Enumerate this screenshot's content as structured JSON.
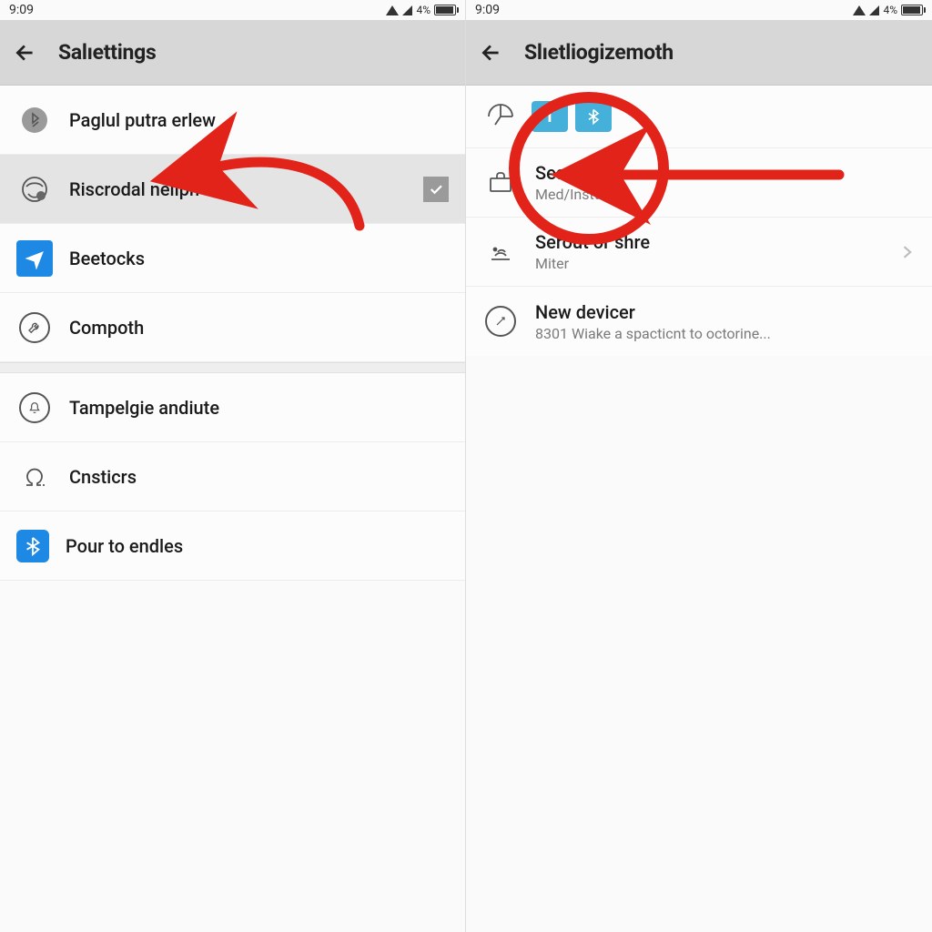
{
  "left": {
    "status": {
      "time": "9:09",
      "battery_pct": "4%"
    },
    "header": {
      "title": "Salıettings"
    },
    "rows": [
      {
        "id": "paglul",
        "label": "Paglul putra erlew",
        "icon": "bluetooth-dot"
      },
      {
        "id": "riscrodal",
        "label": "Riscrodal neliph",
        "icon": "globe-cog",
        "selected": true,
        "checked": true
      },
      {
        "id": "beetocks",
        "label": "Beetocks",
        "icon": "plane-blue"
      },
      {
        "id": "compoth",
        "label": "Compoth",
        "icon": "wrench-ring"
      },
      {
        "gap": true
      },
      {
        "id": "tampelgie",
        "label": "Tampelgie andiute",
        "icon": "bell-ring"
      },
      {
        "id": "cnsticrs",
        "label": "Cnsticrs",
        "icon": "omega"
      },
      {
        "id": "pour",
        "label": "Pour to endles",
        "icon": "bt-blue"
      }
    ]
  },
  "right": {
    "status": {
      "time": "9:09",
      "battery_pct": "4%"
    },
    "header": {
      "title": "Slıetliogizemoth"
    },
    "chips": {
      "icon": "clock-half",
      "items": [
        "T",
        "bt"
      ]
    },
    "rows": [
      {
        "id": "seads",
        "label": "Seads",
        "sub": "Med/Insttuph",
        "icon": "briefcase"
      },
      {
        "id": "serout",
        "label": "Serout or shre",
        "sub": "Miter",
        "icon": "signal",
        "chevron": true
      },
      {
        "id": "newdev",
        "label": "New devicer",
        "sub": "8301 Wiake a spacticnt to octorine...",
        "icon": "dial-ring"
      }
    ]
  },
  "annotations": {
    "left_arrow_color": "#e2231a",
    "right_circle_color": "#e2231a"
  }
}
